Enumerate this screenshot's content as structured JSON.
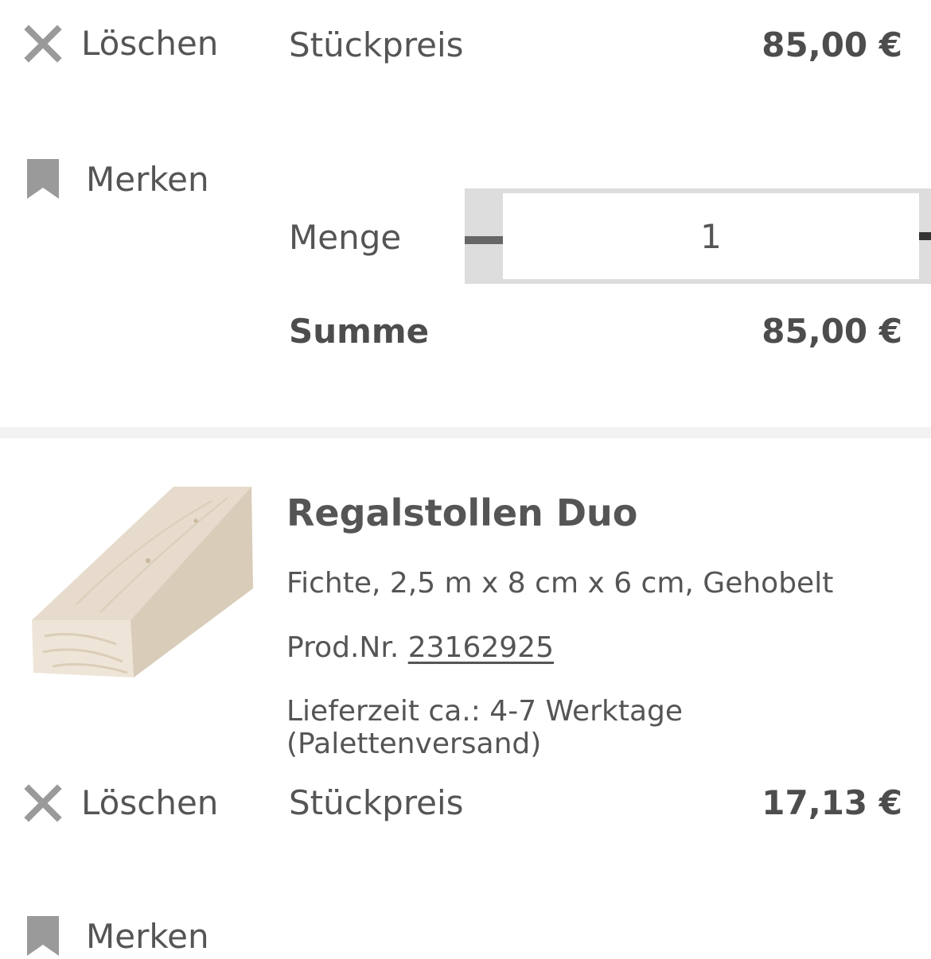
{
  "item1": {
    "delete_label": "Löschen",
    "save_label": "Merken",
    "unit_price_label": "Stückpreis",
    "unit_price": "85,00 €",
    "quantity_label": "Menge",
    "quantity": "1",
    "total_label": "Summe",
    "total": "85,00 €"
  },
  "item2": {
    "title": "Regalstollen Duo",
    "description": "Fichte, 2,5 m x 8 cm x 6 cm, Gehobelt",
    "product_number_label": "Prod.Nr.",
    "product_number": "23162925",
    "delivery_time": "Lieferzeit ca.: 4-7 Werktage (Palettenversand)",
    "delete_label": "Löschen",
    "unit_price_label": "Stückpreis",
    "unit_price": "17,13 €",
    "save_label": "Merken"
  },
  "icons": {
    "delete": "close-icon",
    "save": "bookmark-icon",
    "decrease": "minus-icon",
    "increase": "plus-icon"
  },
  "colors": {
    "text": "#555555",
    "icon": "#9a9a9a",
    "stepper_button": "#dddddd",
    "divider": "#f2f2f2"
  }
}
